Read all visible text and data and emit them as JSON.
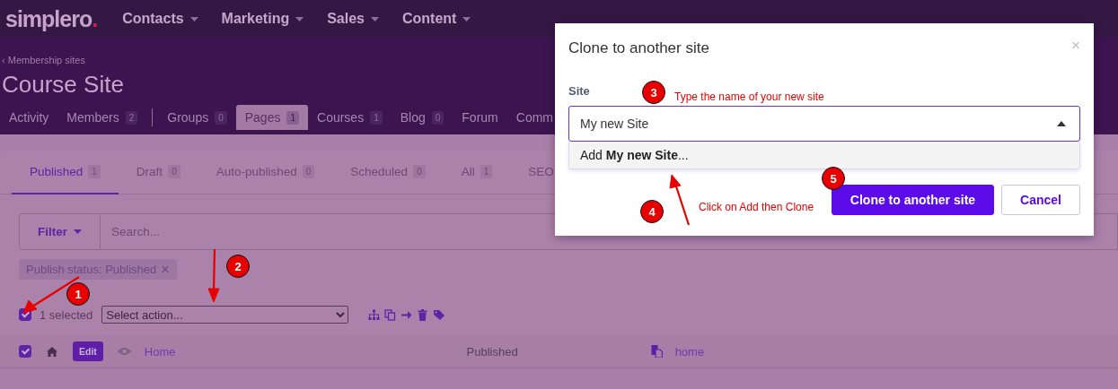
{
  "topnav": {
    "logo": "simplero",
    "logo_dot": ".",
    "items": [
      {
        "label": "Contacts"
      },
      {
        "label": "Marketing"
      },
      {
        "label": "Sales"
      },
      {
        "label": "Content"
      }
    ]
  },
  "header": {
    "breadcrumb": "‹ Membership sites",
    "title": "Course Site",
    "tabs": [
      {
        "label": "Activity",
        "selected": false
      },
      {
        "label": "Members",
        "count": "2",
        "selected": false
      },
      {
        "label": "Groups",
        "count": "0",
        "selected": false
      },
      {
        "label": "Pages",
        "count": "1",
        "selected": true
      },
      {
        "label": "Courses",
        "count": "1",
        "selected": false
      },
      {
        "label": "Blog",
        "count": "0",
        "selected": false
      },
      {
        "label": "Forum",
        "selected": false
      },
      {
        "label": "Comm",
        "selected": false
      }
    ]
  },
  "status_tabs": [
    {
      "label": "Published",
      "count": "1",
      "selected": true
    },
    {
      "label": "Draft",
      "count": "0",
      "selected": false
    },
    {
      "label": "Auto-published",
      "count": "0",
      "selected": false
    },
    {
      "label": "Scheduled",
      "count": "0",
      "selected": false
    },
    {
      "label": "All",
      "count": "1",
      "selected": false
    },
    {
      "label": "SEO",
      "selected": false
    }
  ],
  "filter": {
    "button": "Filter",
    "search_placeholder": "Search...",
    "chips": [
      {
        "label": "Publish status: Published",
        "remove": "×"
      }
    ]
  },
  "bulk": {
    "checked": true,
    "selected_text": "1 selected",
    "action_placeholder": "Select action..."
  },
  "rows": [
    {
      "checked": true,
      "edit": "Edit",
      "title": "Home",
      "status": "Published",
      "slug": "home"
    }
  ],
  "modal": {
    "title": "Clone to another site",
    "close": "×",
    "label": "Site",
    "value": "My new Site",
    "options": [
      {
        "text": "Add **My new Site**..."
      }
    ],
    "buttons": [
      {
        "label": "Clone to another site",
        "kind": "primary"
      },
      {
        "label": "Cancel",
        "kind": "secondary"
      }
    ]
  },
  "annotations": {
    "markers": [
      {
        "number": "1"
      },
      {
        "number": "2"
      },
      {
        "number": "3"
      },
      {
        "number": "4"
      },
      {
        "number": "5"
      }
    ],
    "notes": [
      "Type the name of your new site",
      "Click on Add then Clone"
    ]
  }
}
